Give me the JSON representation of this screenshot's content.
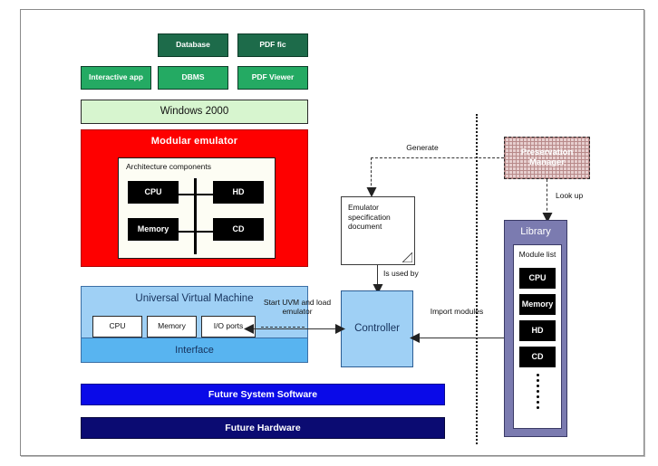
{
  "diagram": {
    "application_layer": {
      "row_top": [
        {
          "label": "Database",
          "style": "dark-green"
        },
        {
          "label": "PDF fic",
          "style": "dark-green"
        }
      ],
      "row_mid": [
        {
          "label": "Interactive app",
          "style": "mid-green"
        },
        {
          "label": "DBMS",
          "style": "mid-green"
        },
        {
          "label": "PDF Viewer",
          "style": "mid-green"
        }
      ],
      "os": {
        "label": "Windows 2000",
        "style": "light-green"
      }
    },
    "modular_emulator": {
      "title": "Modular emulator",
      "inner_label": "Architecture components",
      "components": [
        "CPU",
        "HD",
        "Memory",
        "CD"
      ]
    },
    "uvm": {
      "title": "Universal Virtual Machine",
      "components": [
        "CPU",
        "Memory",
        "I/O ports"
      ],
      "interface": "Interface"
    },
    "future_stack": [
      {
        "label": "Future System Software",
        "style": "blue"
      },
      {
        "label": "Future Hardware",
        "style": "navy"
      }
    ],
    "preservation_manager": {
      "label": "Preservation Manager"
    },
    "document": {
      "label": "Emulator specification document"
    },
    "controller": {
      "label": "Controller"
    },
    "library": {
      "title": "Library",
      "module_list_label": "Module list",
      "modules": [
        "CPU",
        "Memory",
        "HD",
        "CD"
      ]
    },
    "connector_labels": {
      "generate": "Generate",
      "look_up": "Look up",
      "is_used_by": "Is used by",
      "start_uvm": "Start UVM and load emulator",
      "import_modules": "Import modules"
    },
    "colors": {
      "emulator_red": "#fe0000",
      "uvm_blue": "#9fd0f5",
      "interface_blue": "#58b4f0",
      "future_software_blue": "#0a0ae8",
      "future_hardware_navy": "#0b0b72",
      "library_purple": "#7b7bb0",
      "app_dark_green": "#1d6b4a",
      "app_mid_green": "#24aa63",
      "os_light_green": "#d7f5cf"
    }
  }
}
